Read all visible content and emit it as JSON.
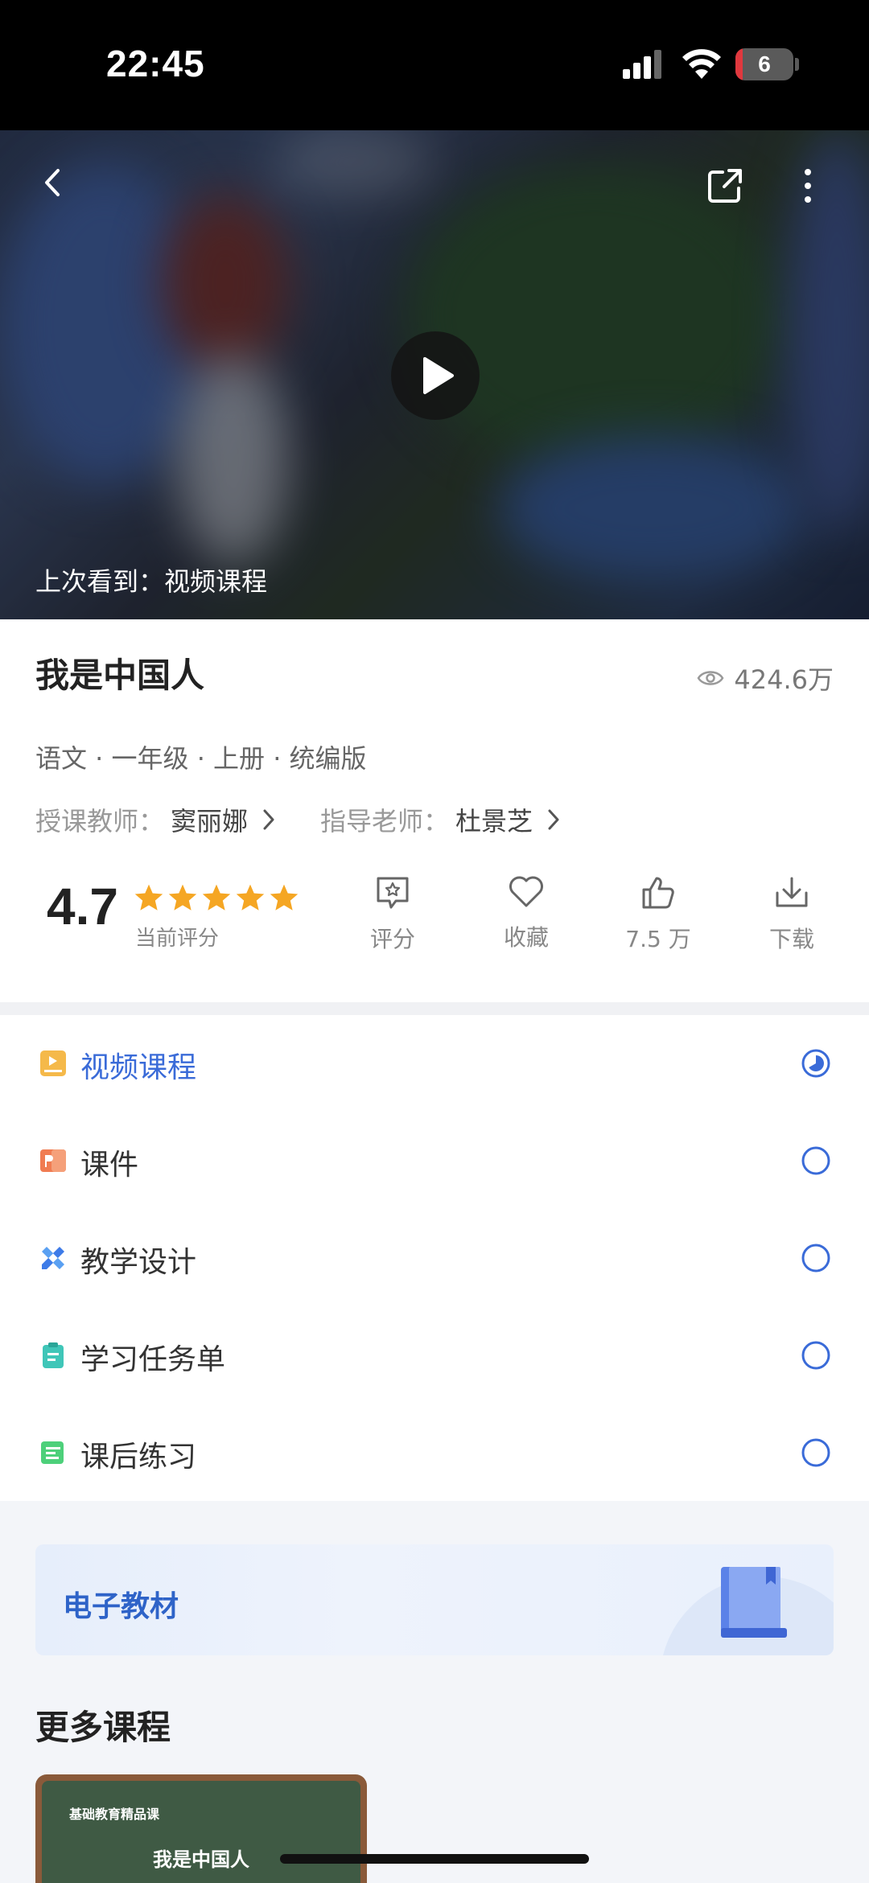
{
  "status_bar": {
    "time": "22:45",
    "battery": "6"
  },
  "video": {
    "last_watched_label": "上次看到：",
    "last_watched_value": "视频课程"
  },
  "course": {
    "title": "我是中国人",
    "views": "424.6万",
    "meta": "语文 · 一年级 · 上册 · 统编版",
    "teacher_label": "授课教师：",
    "teacher_name": "窦丽娜",
    "advisor_label": "指导老师：",
    "advisor_name": "杜景芝",
    "rating": "4.7",
    "rating_caption": "当前评分",
    "star_color": "#f5a623"
  },
  "actions": [
    {
      "label": "评分",
      "icon": "rate-icon"
    },
    {
      "label": "收藏",
      "icon": "heart-icon"
    },
    {
      "label": "7.5 万",
      "icon": "thumbs-up-icon"
    },
    {
      "label": "下载",
      "icon": "download-icon"
    }
  ],
  "resources": [
    {
      "label": "视频课程",
      "icon": "video-course-icon",
      "active": true
    },
    {
      "label": "课件",
      "icon": "courseware-icon",
      "active": false
    },
    {
      "label": "教学设计",
      "icon": "teaching-design-icon",
      "active": false
    },
    {
      "label": "学习任务单",
      "icon": "task-sheet-icon",
      "active": false
    },
    {
      "label": "课后练习",
      "icon": "exercise-icon",
      "active": false
    }
  ],
  "ebook": {
    "label": "电子教材"
  },
  "more_courses": {
    "title": "更多课程",
    "cards": [
      {
        "tag": "基础教育精品课",
        "title": "我是中国人"
      }
    ]
  },
  "colors": {
    "accent": "#3a6bd8",
    "star": "#f5a623"
  }
}
